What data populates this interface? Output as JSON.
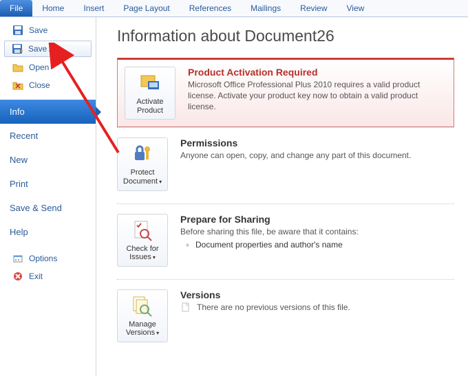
{
  "ribbon": {
    "tabs": [
      "File",
      "Home",
      "Insert",
      "Page Layout",
      "References",
      "Mailings",
      "Review",
      "View"
    ],
    "active_index": 0
  },
  "sidebar": {
    "file_actions": [
      {
        "label": "Save",
        "icon": "save-icon"
      },
      {
        "label": "Save As",
        "icon": "save-as-icon",
        "highlighted": true
      },
      {
        "label": "Open",
        "icon": "open-icon"
      },
      {
        "label": "Close",
        "icon": "close-doc-icon"
      }
    ],
    "nav": [
      {
        "label": "Info",
        "active": true
      },
      {
        "label": "Recent"
      },
      {
        "label": "New"
      },
      {
        "label": "Print"
      },
      {
        "label": "Save & Send"
      },
      {
        "label": "Help"
      }
    ],
    "footer": [
      {
        "label": "Options",
        "icon": "options-icon"
      },
      {
        "label": "Exit",
        "icon": "exit-icon"
      }
    ]
  },
  "page": {
    "title": "Information about Document26"
  },
  "activation": {
    "button_label": "Activate Product",
    "heading": "Product Activation Required",
    "body": "Microsoft Office Professional Plus 2010 requires a valid product license. Activate your product key now to obtain a valid product license."
  },
  "permissions": {
    "button_label_l1": "Protect",
    "button_label_l2": "Document",
    "heading": "Permissions",
    "body": "Anyone can open, copy, and change any part of this document."
  },
  "sharing": {
    "button_label_l1": "Check for",
    "button_label_l2": "Issues",
    "heading": "Prepare for Sharing",
    "body": "Before sharing this file, be aware that it contains:",
    "bullets": [
      "Document properties and author's name"
    ]
  },
  "versions": {
    "button_label_l1": "Manage",
    "button_label_l2": "Versions",
    "heading": "Versions",
    "body": "There are no previous versions of this file."
  }
}
